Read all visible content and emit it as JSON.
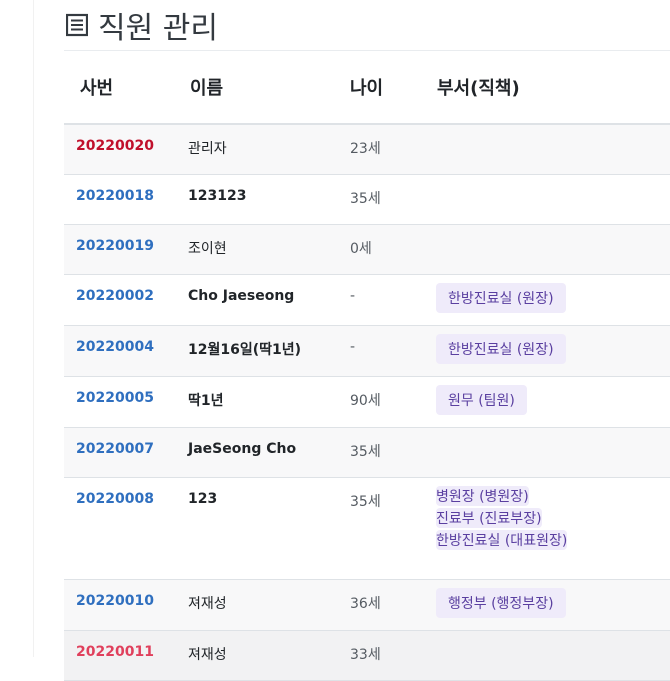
{
  "page": {
    "title": "직원 관리"
  },
  "table": {
    "headers": {
      "id": "사번",
      "name": "이름",
      "age": "나이",
      "dept": "부서(직책)"
    },
    "rows": [
      {
        "id": "20220020",
        "name": "관리자",
        "age": "23세",
        "depts": []
      },
      {
        "id": "20220018",
        "name": "123123",
        "age": "35세",
        "depts": []
      },
      {
        "id": "20220019",
        "name": "조이현",
        "age": "0세",
        "depts": []
      },
      {
        "id": "20220002",
        "name": "Cho Jaeseong",
        "age": "-",
        "depts": [
          "한방진료실 (원장)"
        ]
      },
      {
        "id": "20220004",
        "name": "12월16일(딱1년)",
        "age": "-",
        "depts": [
          "한방진료실 (원장)"
        ]
      },
      {
        "id": "20220005",
        "name": "딱1년",
        "age": "90세",
        "depts": [
          "원무 (팀원)"
        ]
      },
      {
        "id": "20220007",
        "name": "JaeSeong Cho",
        "age": "35세",
        "depts": []
      },
      {
        "id": "20220008",
        "name": "123",
        "age": "35세",
        "depts": [
          "병원장 (병원장)",
          "진료부 (진료부장)",
          "한방진료실 (대표원장)"
        ]
      },
      {
        "id": "20220010",
        "name": "져재성",
        "age": "36세",
        "depts": [
          "행정부 (행정부장)"
        ]
      },
      {
        "id": "20220011",
        "name": "져재성",
        "age": "33세",
        "depts": []
      }
    ]
  },
  "colors": {
    "id_link": "#2f6fbf",
    "id_highlight": "#c0102c",
    "id_alert": "#e0405c",
    "badge_bg": "#efebfa",
    "badge_text": "#5a3fa0"
  },
  "icons": {
    "title_icon": "list-icon"
  }
}
